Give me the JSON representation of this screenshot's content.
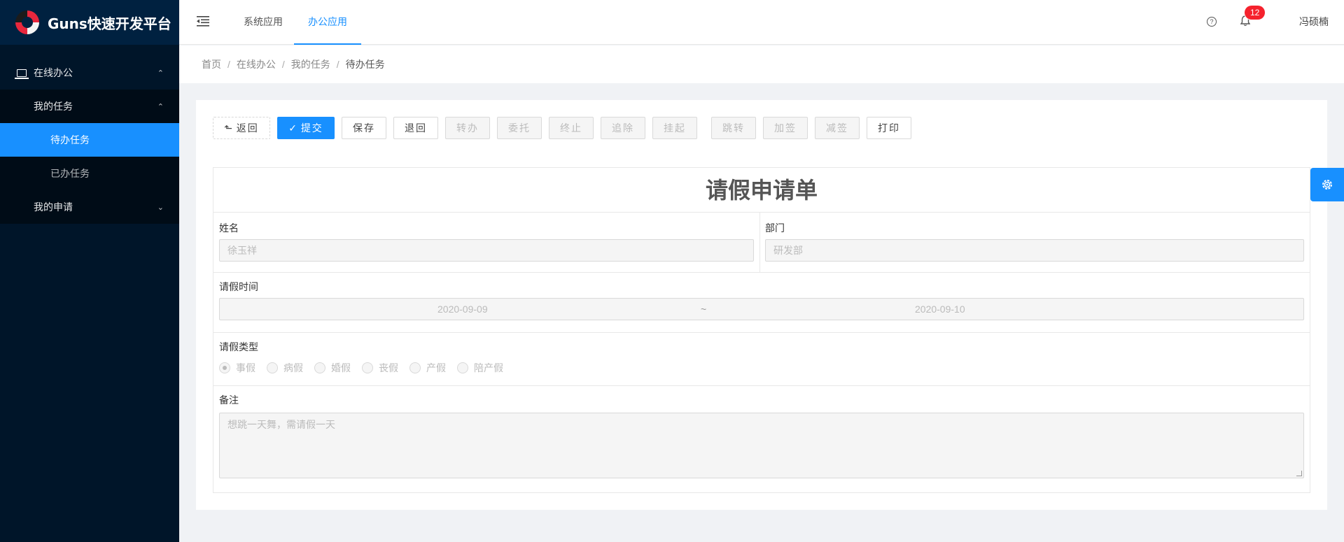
{
  "app": {
    "title": "Guns快速开发平台"
  },
  "sidebar": {
    "group": {
      "label": "在线办公"
    },
    "sub": {
      "label": "我的任务"
    },
    "items": [
      {
        "label": "待办任务",
        "active": true
      },
      {
        "label": "已办任务",
        "active": false
      }
    ],
    "apply": {
      "label": "我的申请"
    }
  },
  "header": {
    "tabs": [
      {
        "label": "系统应用",
        "active": false
      },
      {
        "label": "办公应用",
        "active": true
      }
    ],
    "notification_count": "12",
    "user_name": "冯硕楠"
  },
  "breadcrumb": [
    "首页",
    "在线办公",
    "我的任务",
    "待办任务"
  ],
  "toolbar": {
    "back": "返回",
    "submit": "提交",
    "save": "保存",
    "reject": "退回",
    "transfer": "转办",
    "delegate": "委托",
    "terminate": "终止",
    "revoke": "追除",
    "suspend": "挂起",
    "jump": "跳转",
    "add_sign": "加签",
    "remove_sign": "减签",
    "print": "打印"
  },
  "form": {
    "title": "请假申请单",
    "name": {
      "label": "姓名",
      "value": "徐玉祥"
    },
    "dept": {
      "label": "部门",
      "value": "研发部"
    },
    "period": {
      "label": "请假时间",
      "start": "2020-09-09",
      "separator": "~",
      "end": "2020-09-10"
    },
    "type": {
      "label": "请假类型",
      "options": [
        "事假",
        "病假",
        "婚假",
        "丧假",
        "产假",
        "陪产假"
      ],
      "selected": "事假"
    },
    "remark": {
      "label": "备注",
      "value": "想跳一天舞，需请假一天"
    }
  },
  "colors": {
    "accent": "#1890ff",
    "sider": "#001529",
    "badge": "#f5222d"
  }
}
